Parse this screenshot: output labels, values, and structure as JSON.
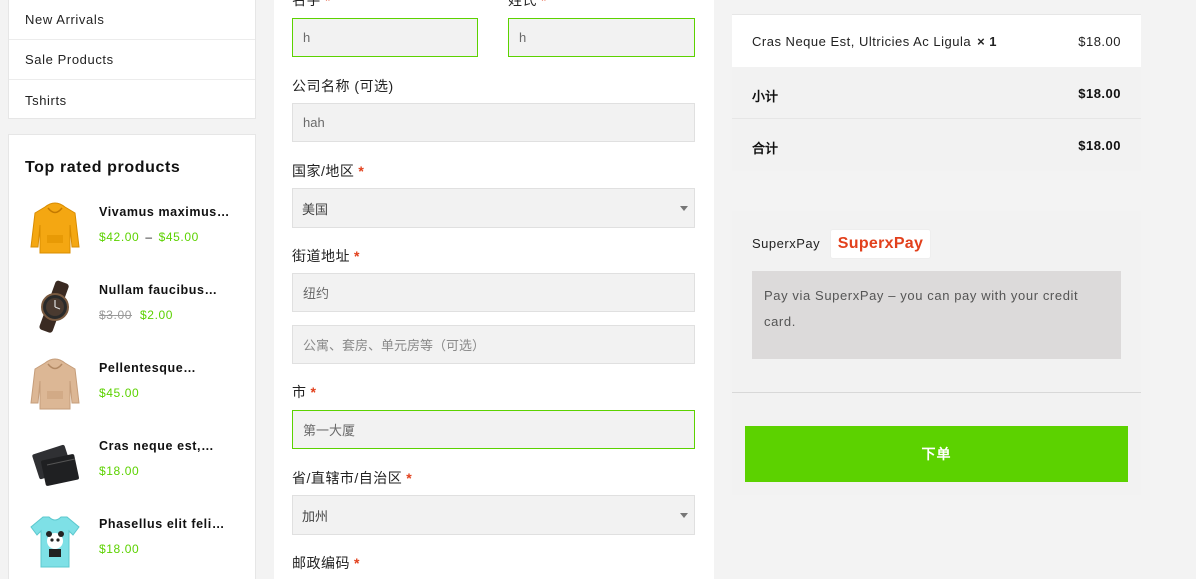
{
  "sidebar": {
    "categories": [
      "New Arrivals",
      "Sale Products",
      "Tshirts"
    ],
    "top_rated": {
      "title": "Top rated products",
      "products": [
        {
          "name": "Vivamus maximus…",
          "price_low": "$42.00",
          "price_high": "$45.00",
          "icon": "yellow-hoodie"
        },
        {
          "name": "Nullam faucibus…",
          "old_price": "$3.00",
          "price": "$2.00",
          "icon": "wrist-watch"
        },
        {
          "name": "Pellentesque…",
          "price": "$45.00",
          "icon": "beige-hoodie"
        },
        {
          "name": "Cras neque est,…",
          "price": "$18.00",
          "icon": "leather-wallet"
        },
        {
          "name": "Phasellus elit feli…",
          "price": "$18.00",
          "icon": "panda-tshirt"
        }
      ]
    }
  },
  "form": {
    "first_name_label": "名字",
    "first_name_value": "h",
    "last_name_label": "姓氏",
    "last_name_value": "h",
    "company_label": "公司名称 (可选)",
    "company_value": "hah",
    "country_label": "国家/地区",
    "country_value": "美国",
    "street_label": "街道地址",
    "street_value": "纽约",
    "street2_placeholder": "公寓、套房、单元房等（可选）",
    "city_label": "市",
    "city_value": "第一大厦",
    "state_label": "省/直辖市/自治区",
    "state_value": "加州",
    "postcode_label": "邮政编码",
    "required_mark": "*"
  },
  "order": {
    "item_name": "Cras Neque Est, Ultricies Ac Ligula",
    "item_qty": "× 1",
    "item_amount": "$18.00",
    "subtotal_label": "小计",
    "subtotal_value": "$18.00",
    "total_label": "合计",
    "total_value": "$18.00"
  },
  "payment": {
    "method_label": "SuperxPay",
    "logo_text": "SuperxPay",
    "description": "Pay via SuperxPay – you can pay with your credit card.",
    "place_order_label": "下单"
  },
  "colors": {
    "accent_green": "#5cd200",
    "required_red": "#e2401c",
    "logo_red": "#e2401c"
  }
}
